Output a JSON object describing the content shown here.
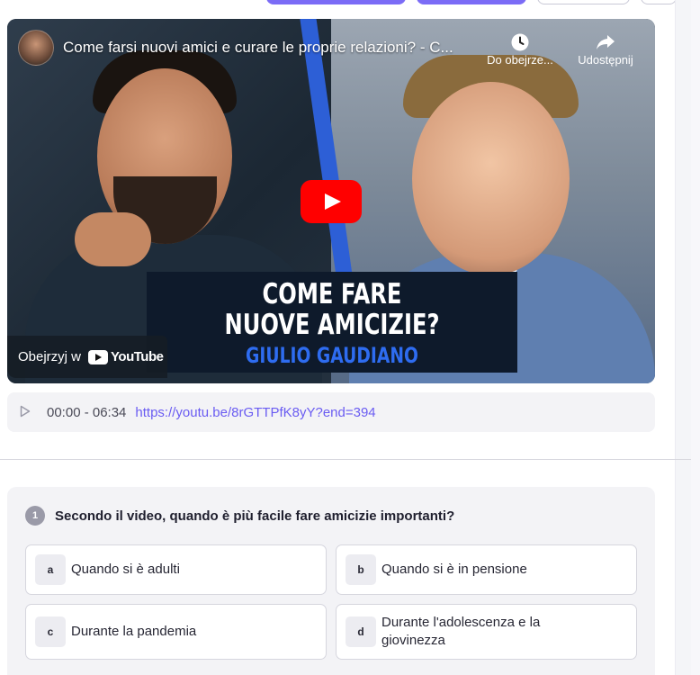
{
  "video": {
    "title": "Come farsi nuovi amici e curare le proprie relazioni? - C...",
    "watch_later_label": "Do obejrze...",
    "share_label": "Udostępnij",
    "banner_line1": "COME FARE",
    "banner_line2": "NUOVE AMICIZIE?",
    "banner_name": "GIULIO GAUDIANO",
    "watch_on_label": "Obejrzyj w",
    "youtube_label": "YouTube"
  },
  "link_bar": {
    "time_range": "00:00 - 06:34",
    "url": "https://youtu.be/8rGTTPfK8yY?end=394"
  },
  "question": {
    "number": "1",
    "text": "Secondo il video, quando è più facile fare amicizie importanti?",
    "options": [
      {
        "letter": "a",
        "label": "Quando si è adulti"
      },
      {
        "letter": "b",
        "label": "Quando si è in pensione"
      },
      {
        "letter": "c",
        "label": "Durante la pandemia"
      },
      {
        "letter": "d",
        "label": "Durante l'adolescenza e la giovinezza"
      }
    ]
  },
  "icons": {
    "clock": "clock-icon",
    "share": "share-icon",
    "play": "play-icon",
    "youtube": "youtube-logo-icon"
  },
  "colors": {
    "accent": "#7b6cf6",
    "link": "#6a5cf2",
    "youtube_red": "#ff0000",
    "banner_bg": "#0e1a2b",
    "banner_name": "#2e6cf0"
  }
}
